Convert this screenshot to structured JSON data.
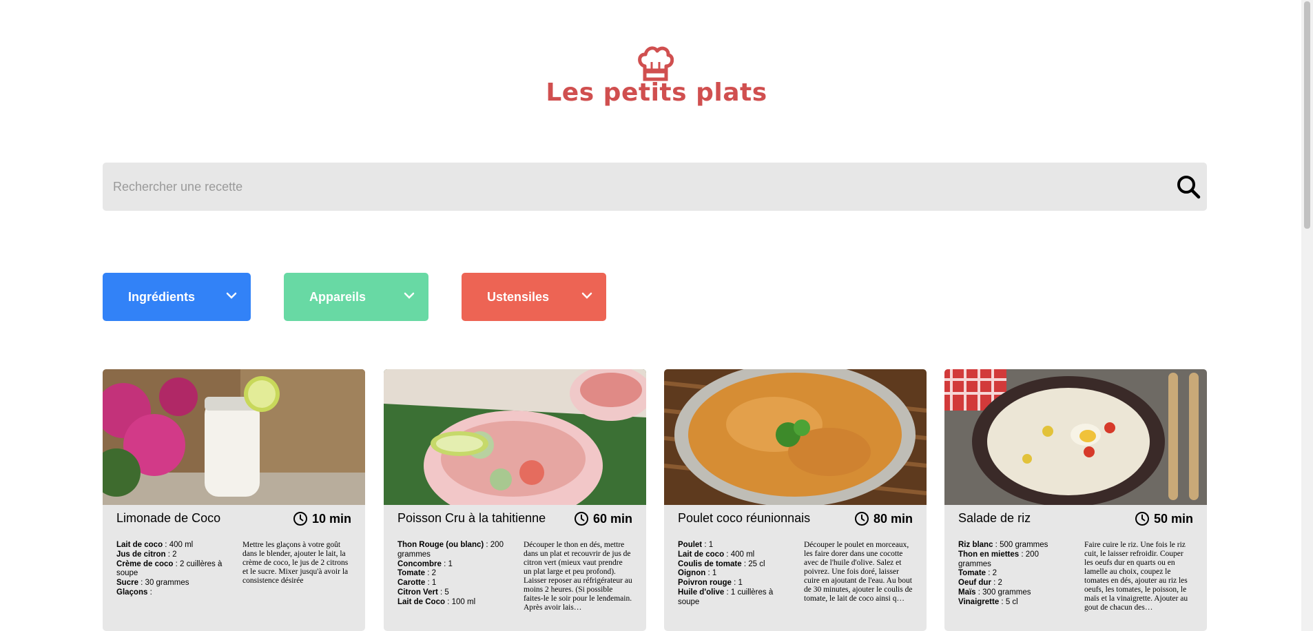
{
  "header": {
    "title": "Les petits plats",
    "logo_icon": "chef-hat-icon",
    "brand_color": "#d04f4f"
  },
  "search": {
    "placeholder": "Rechercher une recette",
    "value": "",
    "icon": "search-icon"
  },
  "filters": [
    {
      "label": "Ingrédients",
      "color": "#3282f7"
    },
    {
      "label": "Appareils",
      "color": "#68d9a4"
    },
    {
      "label": "Ustensiles",
      "color": "#ed6454"
    }
  ],
  "recipes": [
    {
      "name": "Limonade de Coco",
      "time": "10 min",
      "ingredients": [
        {
          "name": "Lait de coco",
          "qty": " : 400 ml"
        },
        {
          "name": "Jus de citron",
          "qty": " : 2"
        },
        {
          "name": "Crème de coco",
          "qty": " : 2 cuillères à soupe"
        },
        {
          "name": "Sucre",
          "qty": " : 30 grammes"
        },
        {
          "name": "Glaçons",
          "qty": " :"
        }
      ],
      "description": "Mettre les glaçons à votre goût dans le blender, ajouter le lait, la crème de coco, le jus de 2 citrons et le sucre. Mixer jusqu'à avoir la consistence désirée"
    },
    {
      "name": "Poisson Cru à la tahitienne",
      "time": "60 min",
      "ingredients": [
        {
          "name": "Thon Rouge (ou blanc)",
          "qty": " : 200 grammes"
        },
        {
          "name": "Concombre",
          "qty": " : 1"
        },
        {
          "name": "Tomate",
          "qty": " : 2"
        },
        {
          "name": "Carotte",
          "qty": " : 1"
        },
        {
          "name": "Citron Vert",
          "qty": " : 5"
        },
        {
          "name": "Lait de Coco",
          "qty": " : 100 ml"
        }
      ],
      "description": "Découper le thon en dés, mettre dans un plat et recouvrir de jus de citron vert (mieux vaut prendre un plat large et peu profond). Laisser reposer au réfrigérateur au moins 2 heures. (Si possible faites-le le soir pour le lendemain. Après avoir lais…"
    },
    {
      "name": "Poulet coco réunionnais",
      "time": "80 min",
      "ingredients": [
        {
          "name": "Poulet",
          "qty": " : 1"
        },
        {
          "name": "Lait de coco",
          "qty": " : 400 ml"
        },
        {
          "name": "Coulis de tomate",
          "qty": " : 25 cl"
        },
        {
          "name": "Oignon",
          "qty": " : 1"
        },
        {
          "name": "Poivron rouge",
          "qty": " : 1"
        },
        {
          "name": "Huile d'olive",
          "qty": " : 1 cuillères à soupe"
        }
      ],
      "description": "Découper le poulet en morceaux, les faire dorer dans une cocotte avec de l'huile d'olive. Salez et poivrez. Une fois doré, laisser cuire en ajoutant de l'eau. Au bout de 30 minutes, ajouter le coulis de tomate, le lait de coco ainsi q…"
    },
    {
      "name": "Salade de riz",
      "time": "50 min",
      "ingredients": [
        {
          "name": "Riz blanc",
          "qty": " : 500 grammes"
        },
        {
          "name": "Thon en miettes",
          "qty": " : 200 grammes"
        },
        {
          "name": "Tomate",
          "qty": " : 2"
        },
        {
          "name": "Oeuf dur",
          "qty": " : 2"
        },
        {
          "name": "Maïs",
          "qty": " : 300 grammes"
        },
        {
          "name": "Vinaigrette",
          "qty": " : 5 cl"
        }
      ],
      "description": "Faire cuire le riz. Une fois le riz cuit, le laisser refroidir. Couper les oeufs dur en quarts ou en lamelle au choix, coupez le tomates en dés, ajouter au riz les oeufs, les tomates, le poisson, le maïs et la vinaigrette. Ajouter au gout de chacun des…"
    }
  ]
}
